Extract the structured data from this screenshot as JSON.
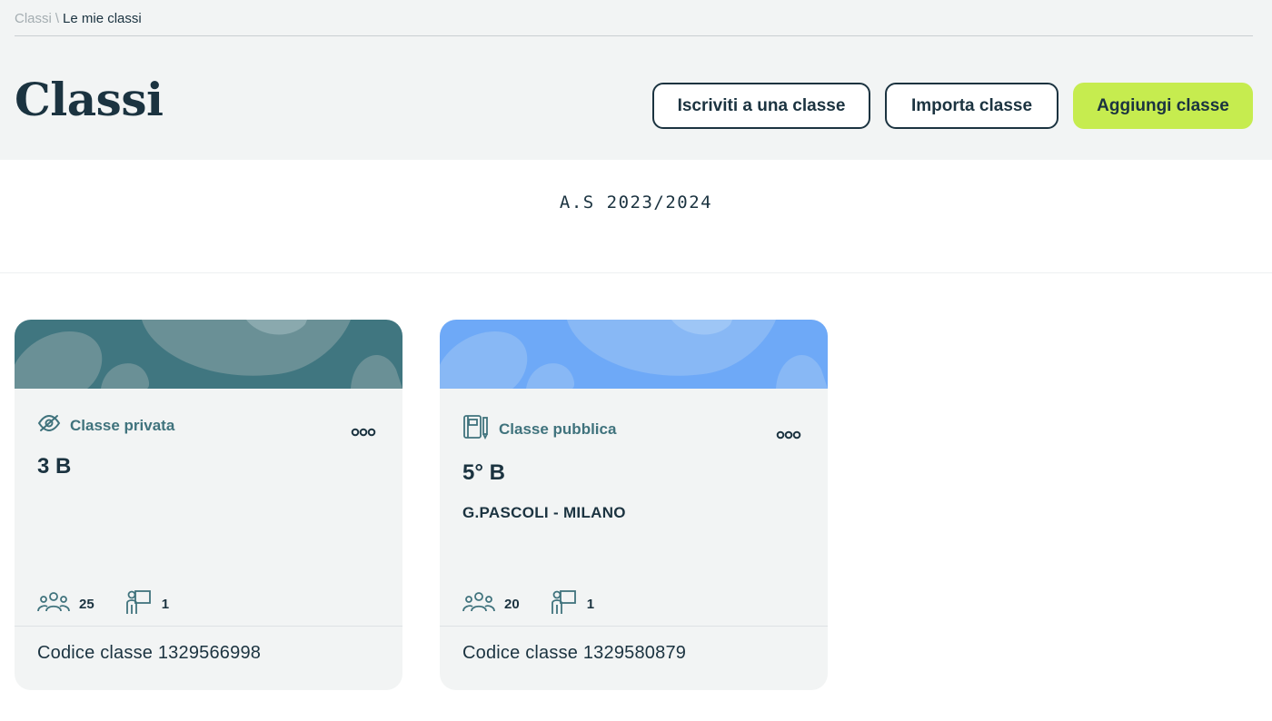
{
  "breadcrumb": {
    "root": "Classi",
    "separator": "\\",
    "current": "Le mie classi"
  },
  "page_title": "Classi",
  "actions": {
    "join_label": "Iscriviti a una classe",
    "import_label": "Importa classe",
    "add_label": "Aggiungi classe",
    "add_color": "#c6ec4f"
  },
  "school_year": "A.S 2023/2024",
  "classes": [
    {
      "visibility": "Classe privata",
      "visibility_icon": "eye-off-icon",
      "name": "3 B",
      "school": "",
      "students": "25",
      "teachers": "1",
      "code": "Codice classe 1329566998",
      "banner_color": "#407680"
    },
    {
      "visibility": "Classe pubblica",
      "visibility_icon": "notebook-icon",
      "name": "5° B",
      "school": "G.PASCOLI - MILANO",
      "students": "20",
      "teachers": "1",
      "code": "Codice classe 1329580879",
      "banner_color": "#6ea9f7"
    }
  ]
}
